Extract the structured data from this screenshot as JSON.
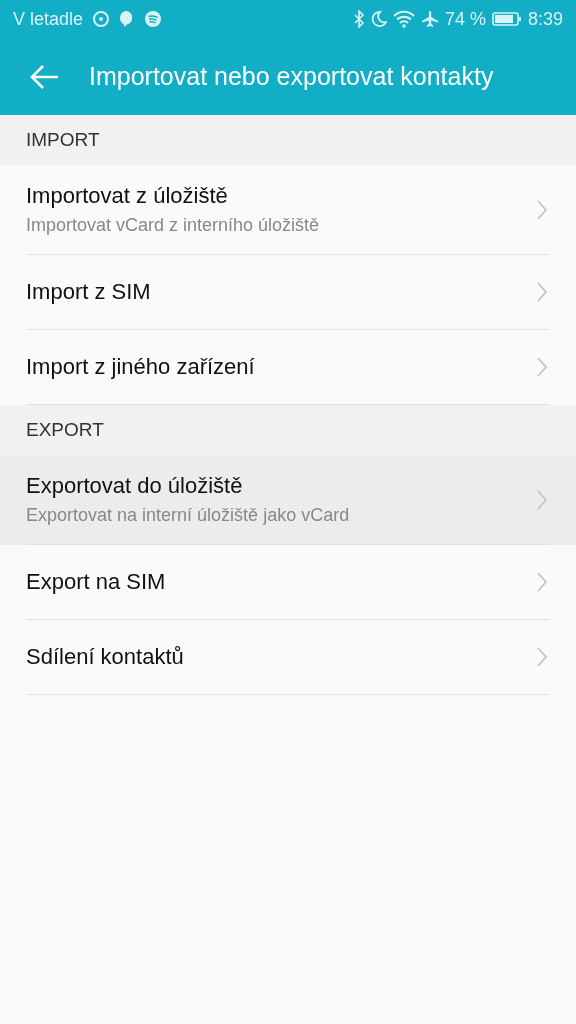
{
  "status_bar": {
    "carrier": "V letadle",
    "battery": "74 %",
    "time": "8:39"
  },
  "app_bar": {
    "title": "Importovat nebo exportovat kontakty"
  },
  "sections": [
    {
      "header": "IMPORT",
      "items": [
        {
          "title": "Importovat z úložiště",
          "subtitle": "Importovat vCard z interního úložiště",
          "selected": false
        },
        {
          "title": "Import z SIM",
          "selected": false
        },
        {
          "title": "Import z jiného zařízení",
          "selected": false
        }
      ]
    },
    {
      "header": "EXPORT",
      "items": [
        {
          "title": "Exportovat do úložiště",
          "subtitle": "Exportovat na interní úložiště jako vCard",
          "selected": true
        },
        {
          "title": "Export na SIM",
          "selected": false
        },
        {
          "title": "Sdílení kontaktů",
          "selected": false
        }
      ]
    }
  ]
}
